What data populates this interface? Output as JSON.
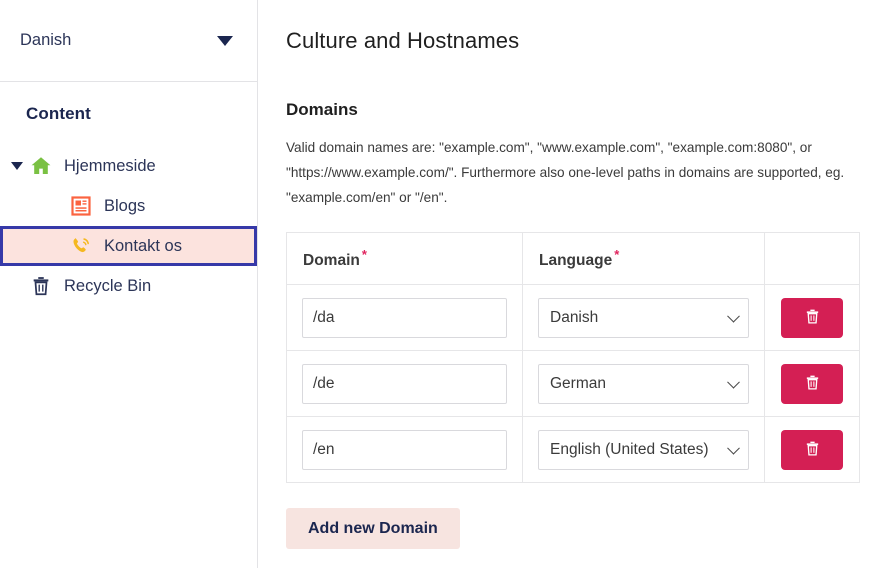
{
  "sidebar": {
    "language_switcher": {
      "value": "Danish",
      "icon": "caret-down-icon"
    },
    "tree_title": "Content",
    "tree_items": [
      {
        "label": "Hjemmeside",
        "icon": "home-icon",
        "level": 1,
        "expanded": true,
        "selected": false
      },
      {
        "label": "Blogs",
        "icon": "article-icon",
        "level": 2,
        "expanded": false,
        "selected": false
      },
      {
        "label": "Kontakt os",
        "icon": "phone-icon",
        "level": 2,
        "expanded": false,
        "selected": true
      },
      {
        "label": "Recycle Bin",
        "icon": "trash-icon",
        "level": 1,
        "expanded": false,
        "selected": false
      }
    ]
  },
  "main": {
    "title": "Culture and Hostnames",
    "section_title": "Domains",
    "helptext": "Valid domain names are: \"example.com\", \"www.example.com\", \"example.com:8080\", or \"https://www.example.com/\". Furthermore also one-level paths in domains are supported, eg. \"example.com/en\" or \"/en\".",
    "table": {
      "headers": {
        "domain": "Domain",
        "language": "Language",
        "required_marker": "*"
      },
      "rows": [
        {
          "domain": "/da",
          "language": "Danish",
          "delete_icon": "trash-icon"
        },
        {
          "domain": "/de",
          "language": "German",
          "delete_icon": "trash-icon"
        },
        {
          "domain": "/en",
          "language": "English (United States)",
          "delete_icon": "trash-icon"
        }
      ]
    },
    "add_button": "Add new Domain"
  },
  "colors": {
    "accent_blue": "#3639a8",
    "selected_bg": "#fce3de",
    "danger": "#d41f54",
    "add_button_bg": "#f7e4e0",
    "navy_text": "#1b264f",
    "home_green": "#7ac143",
    "article_orange": "#fb6340",
    "phone_yellow": "#f5b820",
    "required_pink": "#e0245e"
  }
}
